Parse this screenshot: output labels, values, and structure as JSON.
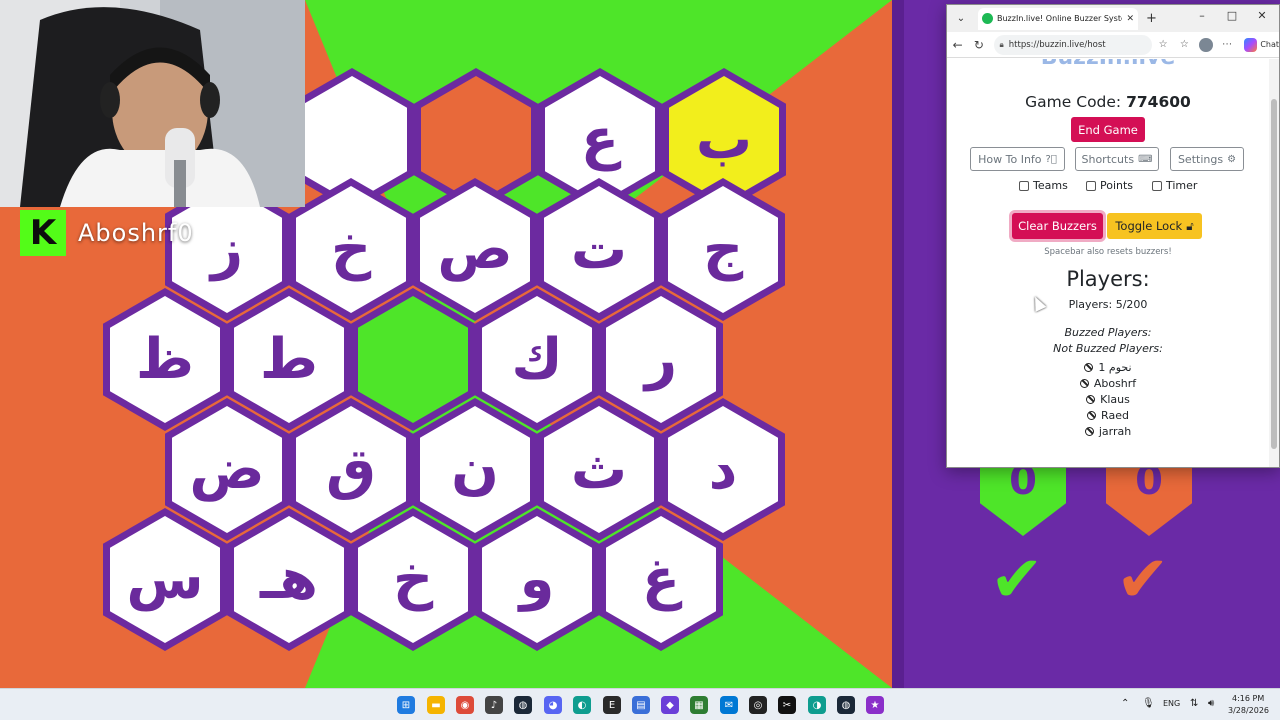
{
  "streamer": {
    "platform_icon": "kick-logo",
    "logo_letter": "K",
    "name": "Aboshrf0"
  },
  "board": {
    "colors": {
      "orange": "#e8693a",
      "green": "#4ee529",
      "purple": "#6c2aa0",
      "yellow": "#f2ee1c",
      "white": "#ffffff"
    },
    "rows": [
      [
        {
          "letter": "",
          "state": "white"
        },
        {
          "letter": "",
          "state": "orange"
        },
        {
          "letter": "ع",
          "state": "white"
        },
        {
          "letter": "ب",
          "state": "yellow"
        }
      ],
      [
        {
          "letter": "ز",
          "state": "white"
        },
        {
          "letter": "خ",
          "state": "white"
        },
        {
          "letter": "ص",
          "state": "white"
        },
        {
          "letter": "ت",
          "state": "white"
        },
        {
          "letter": "ج",
          "state": "white"
        }
      ],
      [
        {
          "letter": "ظ",
          "state": "white"
        },
        {
          "letter": "ط",
          "state": "white"
        },
        {
          "letter": "",
          "state": "green"
        },
        {
          "letter": "ك",
          "state": "white"
        },
        {
          "letter": "ر",
          "state": "white"
        }
      ],
      [
        {
          "letter": "ض",
          "state": "white"
        },
        {
          "letter": "ق",
          "state": "white"
        },
        {
          "letter": "ن",
          "state": "white"
        },
        {
          "letter": "ث",
          "state": "white"
        },
        {
          "letter": "د",
          "state": "white"
        }
      ],
      [
        {
          "letter": "س",
          "state": "white"
        },
        {
          "letter": "هـ",
          "state": "white"
        },
        {
          "letter": "خ",
          "state": "white"
        },
        {
          "letter": "و",
          "state": "white"
        },
        {
          "letter": "غ",
          "state": "white"
        }
      ]
    ]
  },
  "scoreboard": {
    "green_score": "0",
    "orange_score": "0",
    "green_check_icon": "checkmark-icon",
    "orange_check_icon": "checkmark-icon"
  },
  "browser": {
    "tab_title": "BuzzIn.live! Online Buzzer System",
    "url": "https://buzzin.live/host",
    "chat_label": "Chat"
  },
  "host": {
    "game_code_label": "Game Code:",
    "game_code": "774600",
    "end_game": "End Game",
    "how_to_info": "How To Info",
    "shortcuts": "Shortcuts",
    "settings": "Settings",
    "teams": "Teams",
    "points": "Points",
    "timer": "Timer",
    "clear_buzzers": "Clear Buzzers",
    "toggle_lock": "Toggle Lock",
    "spacebar_note": "Spacebar also resets buzzers!",
    "players_heading": "Players:",
    "players_count": "Players: 5/200",
    "buzzed_heading": "Buzzed Players:",
    "not_buzzed_heading": "Not Buzzed Players:",
    "players": [
      "نحوم 1",
      "Aboshrf",
      "Klaus",
      "Raed",
      "jarrah"
    ]
  },
  "taskbar": {
    "lang": "ENG",
    "time": "4:16 PM",
    "date": "3/28/2026"
  }
}
